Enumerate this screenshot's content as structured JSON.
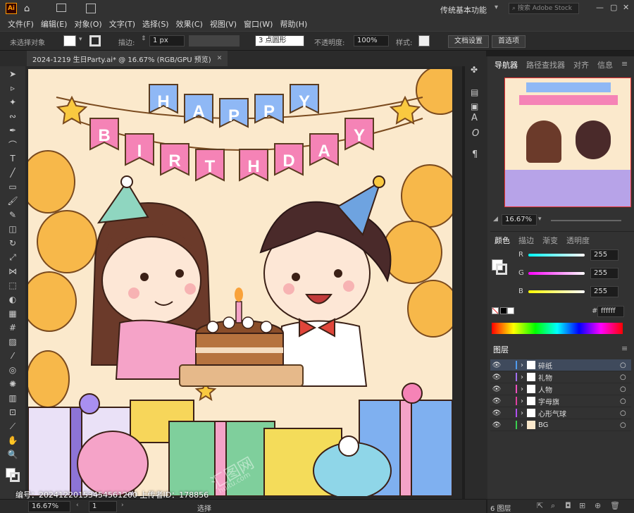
{
  "app": {
    "logo": "Ai",
    "workspace": "传统基本功能",
    "stock_search_placeholder": "搜索 Adobe Stock"
  },
  "menu": [
    "文件(F)",
    "编辑(E)",
    "对象(O)",
    "文字(T)",
    "选择(S)",
    "效果(C)",
    "视图(V)",
    "窗口(W)",
    "帮助(H)"
  ],
  "control": {
    "selection": "未选择对象",
    "stroke_label": "描边:",
    "stroke_value": "1 px",
    "brush": "3 点圆形",
    "opacity_label": "不透明度:",
    "opacity_value": "100%",
    "style_label": "样式:",
    "doc_settings": "文档设置",
    "preferences": "首选项"
  },
  "tab": {
    "title": "2024-1219 生日Party.ai* @ 16.67% (RGB/GPU 预览)",
    "close": "✕"
  },
  "artwork": {
    "banner_top": [
      "H",
      "A",
      "P",
      "P",
      "Y"
    ],
    "banner_bottom": [
      "B",
      "I",
      "R",
      "T",
      "H",
      "D",
      "A",
      "Y"
    ]
  },
  "watermark": {
    "text": "编号：20241220153454561200  上传者ID：178856",
    "logo": "汇图网",
    "site": "huitu.com"
  },
  "status": {
    "zoom": "16.67%",
    "page": "1",
    "tool": "选择"
  },
  "navigator": {
    "tabs": [
      "导航器",
      "路径查找器",
      "对齐",
      "信息"
    ],
    "zoom": "16.67%"
  },
  "color": {
    "tabs": [
      "颜色",
      "描边",
      "渐变",
      "透明度"
    ],
    "r_label": "R",
    "g_label": "G",
    "b_label": "B",
    "r": "255",
    "g": "255",
    "b": "255",
    "hex_prefix": "#",
    "hex": "ffffff"
  },
  "layers": {
    "tab": "图层",
    "items": [
      {
        "name": "碎纸",
        "color": "#4f9bf0"
      },
      {
        "name": "礼物",
        "color": "#a070f0"
      },
      {
        "name": "人物",
        "color": "#f050c0"
      },
      {
        "name": "字母旗",
        "color": "#e040a0"
      },
      {
        "name": "心形气球",
        "color": "#b050f0"
      },
      {
        "name": "BG",
        "color": "#3ad050"
      }
    ],
    "count": "6 图层"
  }
}
